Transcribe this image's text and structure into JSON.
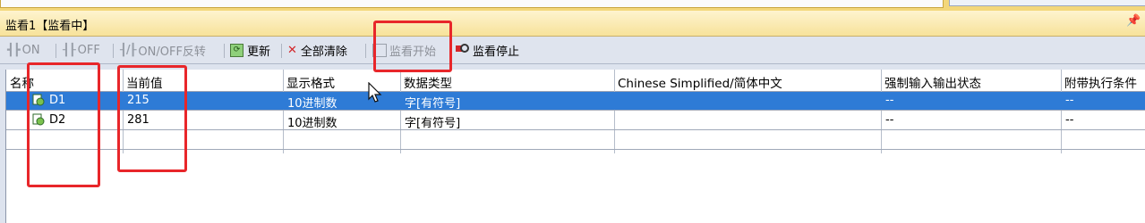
{
  "window": {
    "title": "监看1【监看中】",
    "pin_glyph": "ᵖ"
  },
  "toolbar": {
    "on": "ON",
    "off": "OFF",
    "on_off_toggle": "ON/OFF反转",
    "refresh": "更新",
    "clear_all": "全部清除",
    "start_monitor": "监看开始",
    "stop_monitor": "监看停止"
  },
  "table": {
    "columns": [
      "名称",
      "当前值",
      "显示格式",
      "数据类型",
      "Chinese Simplified/简体中文",
      "强制输入输出状态",
      "附带执行条件的"
    ],
    "rows": [
      {
        "name": "D1",
        "value": "215",
        "format": "10进制数",
        "dtype": "字[有符号]",
        "comment": "",
        "force": "--",
        "cond": "--",
        "selected": true
      },
      {
        "name": "D2",
        "value": "281",
        "format": "10进制数",
        "dtype": "字[有符号]",
        "comment": "",
        "force": "--",
        "cond": "--",
        "selected": false
      }
    ]
  },
  "colors": {
    "selection": "#2e7bd6",
    "annotation_red": "#e8262a",
    "title_bg": "#f7e29a"
  }
}
